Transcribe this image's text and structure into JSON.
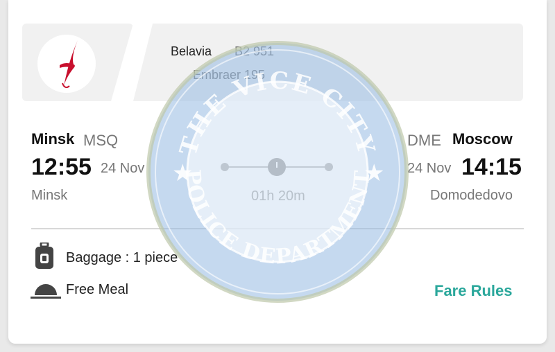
{
  "flight": {
    "airline": "Belavia",
    "flight_number": "B2 951",
    "aircraft": "Embraer 195"
  },
  "departure": {
    "city": "Minsk",
    "code": "MSQ",
    "time": "12:55",
    "date": "24 Nov",
    "airport": "Minsk"
  },
  "arrival": {
    "city": "Moscow",
    "code": "DME",
    "time": "14:15",
    "date": "24 Nov",
    "airport": "Domodedovo"
  },
  "duration": "01h 20m",
  "amenities": {
    "baggage": "Baggage : 1 piece",
    "meal": "Free Meal"
  },
  "actions": {
    "fare_rules": "Fare Rules"
  },
  "watermark": {
    "top_text": "THE VICE CITY",
    "bottom_text": "POLICE DEPARTMENT"
  },
  "colors": {
    "accent": "#2aa79b",
    "logo_red": "#c8102e",
    "seal_blue": "#8fb0d8"
  },
  "icons": [
    "airline-logo-icon",
    "clock-icon",
    "baggage-icon",
    "meal-cloche-icon"
  ]
}
